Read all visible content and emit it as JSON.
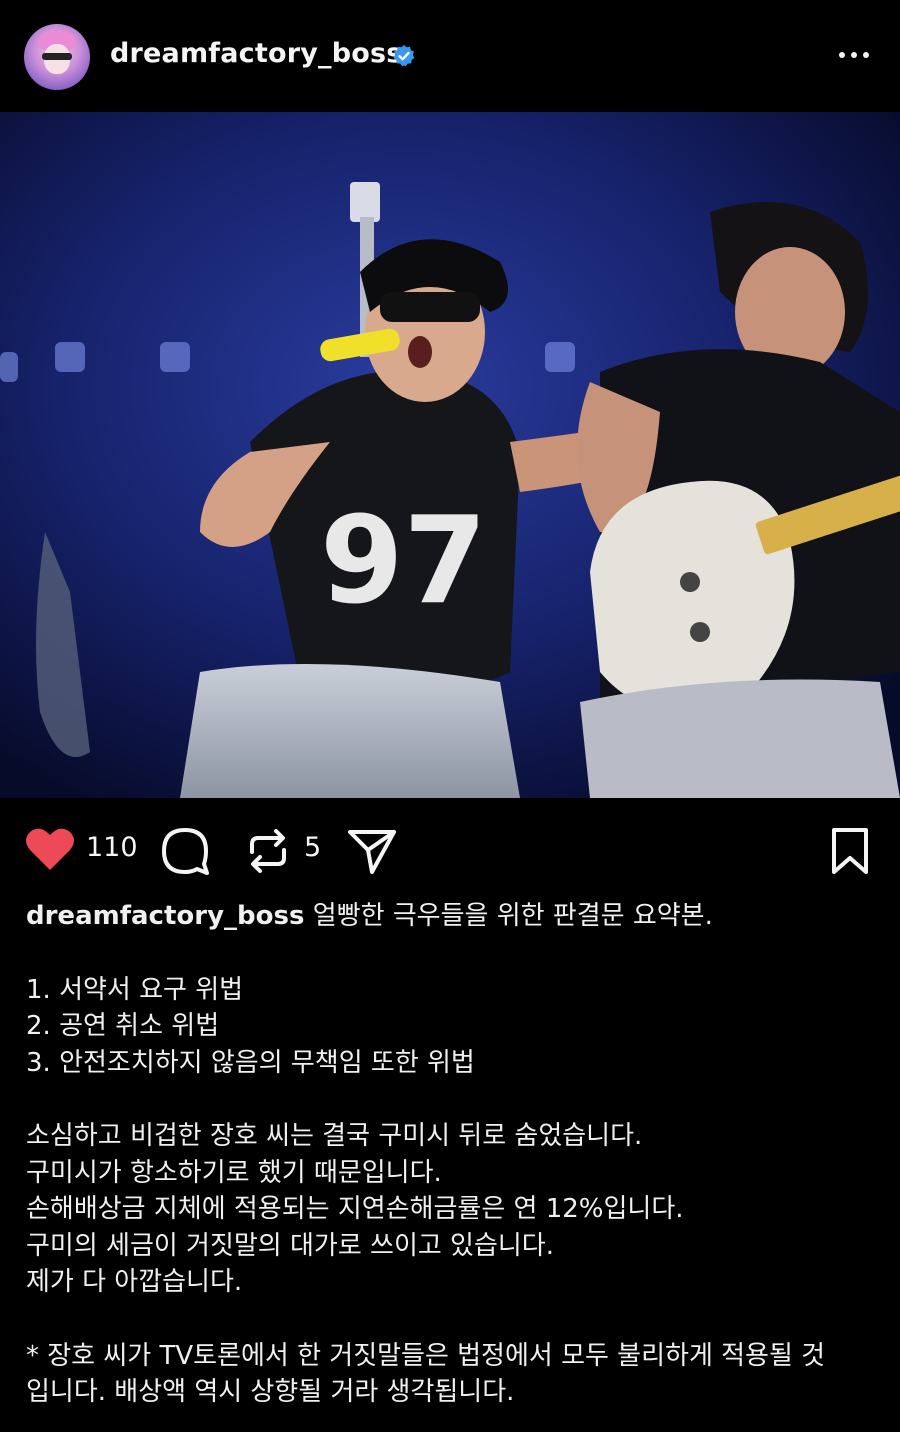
{
  "post": {
    "username": "dreamfactory_boss",
    "verified_icon": "verified-badge-icon",
    "more_icon": "more-options-icon",
    "avatar": "profile-avatar"
  },
  "photo": {
    "jersey_number": "97"
  },
  "actions": {
    "likes": "110",
    "reposts": "5",
    "like_color": "#ed4956"
  },
  "caption": {
    "username": "dreamfactory_boss",
    "intro": " 얼빵한 극우들을 위한 판결문 요약본.",
    "list": [
      "1. 서약서 요구 위법",
      "2. 공연 취소 위법",
      "3. 안전조치하지 않음의 무책임 또한 위법"
    ],
    "paragraph": [
      "소심하고 비겁한 장호 씨는 결국 구미시 뒤로 숨었습니다.",
      "구미시가 항소하기로 했기 때문입니다.",
      "손해배상금 지체에 적용되는 지연손해금률은 연 12%입니다.",
      "구미의 세금이 거짓말의 대가로 쓰이고 있습니다.",
      "제가 다 아깝습니다."
    ],
    "note": [
      "* 장호 씨가 TV토론에서 한 거짓말들은 법정에서 모두 불리하게 적용될 것",
      "입니다. 배상액 역시 상향될 거라 생각됩니다."
    ]
  }
}
